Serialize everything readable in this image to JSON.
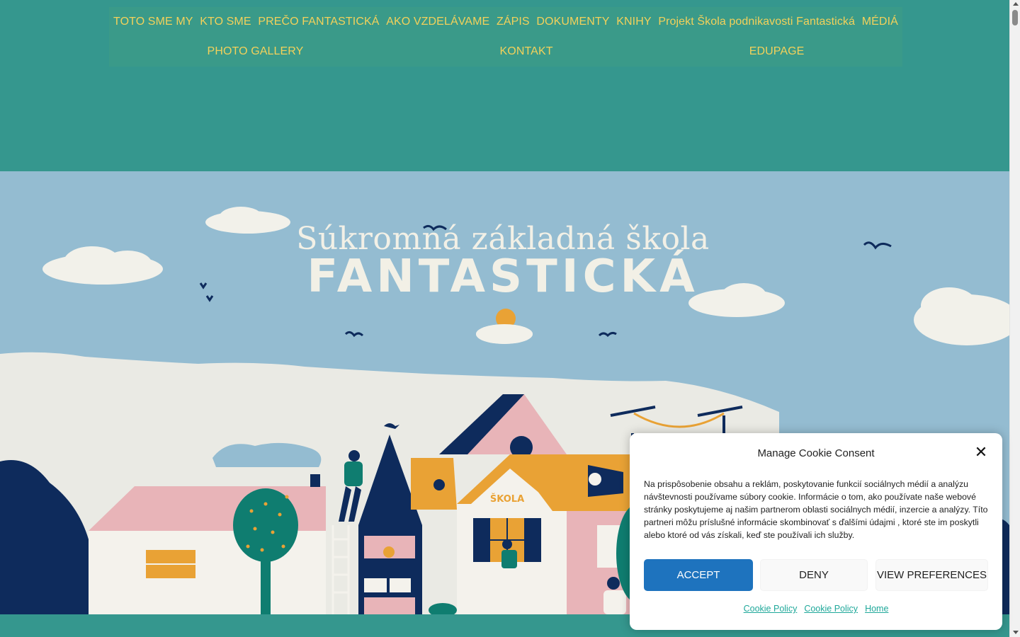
{
  "nav": {
    "row1": [
      "TOTO SME MY",
      "KTO SME",
      "PREČO FANTASTICKÁ",
      "AKO VZDELÁVAME",
      "ZÁPIS",
      "DOKUMENTY",
      "KNIHY",
      "Projekt Škola podnikavosti Fantastická",
      "MÉDIÁ"
    ],
    "row2": [
      "PHOTO GALLERY",
      "KONTAKT",
      "EDUPAGE"
    ]
  },
  "hero": {
    "title_line1": "Súkromná základná škola",
    "title_line2": "FANTASTICKÁ",
    "sign_text": "ŠKOLA"
  },
  "cookie": {
    "title": "Manage Cookie Consent",
    "close_symbol": "✕",
    "text": "Na prispôsobenie obsahu a reklám, poskytovanie funkcií sociálnych médií a analýzu návštevnosti používame súbory cookie. Informácie o tom, ako používate naše webové stránky poskytujeme aj našim partnerom oblasti sociálnych médií, inzercie a analýzy. Títo partneri môžu príslušné informácie skombinovať s ďalšími údajmi , ktoré ste im poskytli alebo ktoré od vás získali, keď ste používali ich služby.",
    "accept_label": "ACCEPT",
    "deny_label": "DENY",
    "preferences_label": "VIEW PREFERENCES",
    "links": [
      "Cookie Policy",
      "Cookie Policy",
      "Home"
    ]
  },
  "colors": {
    "teal": "#35978e",
    "menu_text": "#f3d15a",
    "sky": "#94bcd1",
    "navy": "#0e2b5c",
    "pink": "#e8b4b8",
    "orange": "#e9a235",
    "accept_blue": "#1e73be",
    "link_teal": "#1fa89a"
  }
}
